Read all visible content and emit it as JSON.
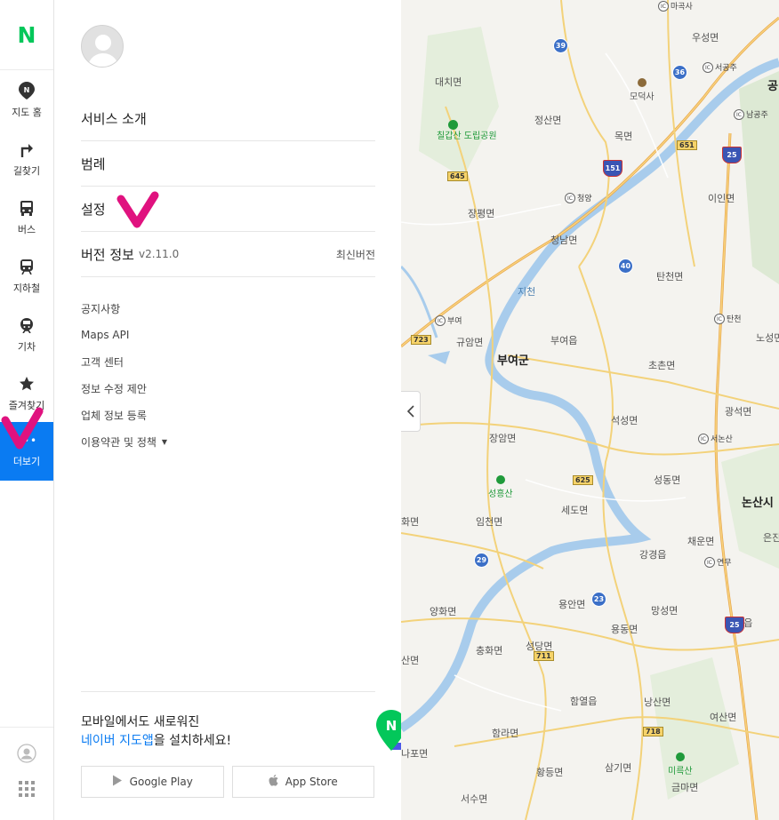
{
  "rail": {
    "logo": "N",
    "items": [
      {
        "label": "지도 홈"
      },
      {
        "label": "길찾기"
      },
      {
        "label": "버스"
      },
      {
        "label": "지하철"
      },
      {
        "label": "기차"
      },
      {
        "label": "즐겨찾기"
      },
      {
        "label": "더보기"
      }
    ]
  },
  "menu": {
    "main": [
      {
        "label": "서비스 소개"
      },
      {
        "label": "범례"
      },
      {
        "label": "설정"
      },
      {
        "label": "버전 정보",
        "version": "v2.11.0",
        "status": "최신버전"
      }
    ],
    "sub": [
      {
        "label": "공지사항"
      },
      {
        "label": "Maps API"
      },
      {
        "label": "고객 센터"
      },
      {
        "label": "정보 수정 제안"
      },
      {
        "label": "업체 정보 등록"
      },
      {
        "label": "이용약관 및 정책"
      }
    ],
    "promo": {
      "line1": "모바일에서도 새로워진",
      "line2_highlight": "네이버 지도앱",
      "line2_rest": "을 설치하세요!"
    },
    "stores": {
      "google": "Google Play",
      "apple": "App Store"
    }
  },
  "map": {
    "cities": [
      "부여군",
      "논산시",
      "공"
    ],
    "towns": [
      "대치면",
      "정산면",
      "목면",
      "장평면",
      "청남면",
      "이인면",
      "탄천면",
      "규암면",
      "부여읍",
      "초촌면",
      "장암면",
      "석성면",
      "광석면",
      "성동면",
      "세도면",
      "임천면",
      "채운면",
      "강경읍",
      "양화면",
      "용안면",
      "망성면",
      "충화면",
      "성당면",
      "용동면",
      "연무읍",
      "함열읍",
      "낭산면",
      "여산면",
      "함라면",
      "황등면",
      "삼기면",
      "금마면",
      "서수면",
      "나포면",
      "노성면",
      "은진",
      "우성면",
      "화면",
      "산면"
    ],
    "pois": [
      "칠갑산 도립공원",
      "모덕사",
      "성흥산",
      "미륵산"
    ],
    "interchanges": [
      "마곡사",
      "서공주",
      "남공주",
      "청양",
      "부여",
      "탄천",
      "서논산",
      "연무"
    ],
    "labels_misc": [
      "지천"
    ],
    "routes": [
      "39",
      "36",
      "651",
      "25",
      "151",
      "645",
      "40",
      "723",
      "625",
      "29",
      "23",
      "711",
      "718",
      "25"
    ],
    "pin_label": "N"
  },
  "colors": {
    "accent": "#0a7bf2",
    "brand": "#03c75a",
    "annotation": "#e0127f"
  }
}
